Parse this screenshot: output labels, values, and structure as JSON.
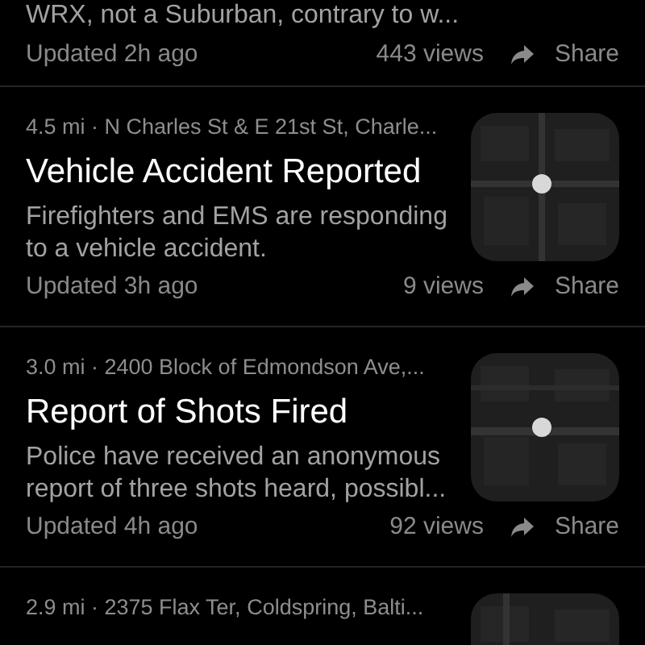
{
  "incidents": [
    {
      "description": "WRX, not a Suburban, contrary to w...",
      "updated": "Updated 2h ago",
      "views": "443 views",
      "share": "Share"
    },
    {
      "meta": "4.5 mi · N Charles St & E 21st St, Charle...",
      "title": "Vehicle Accident Reported",
      "description": "Firefighters and EMS are responding to a vehicle accident.",
      "updated": "Updated 3h ago",
      "views": "9 views",
      "share": "Share"
    },
    {
      "meta": "3.0 mi · 2400 Block of Edmondson Ave,...",
      "title": "Report of Shots Fired",
      "description": "Police have received an anonymous report of three shots heard, possibl...",
      "updated": "Updated 4h ago",
      "views": "92 views",
      "share": "Share"
    },
    {
      "meta": "2.9 mi · 2375 Flax Ter, Coldspring, Balti..."
    }
  ]
}
